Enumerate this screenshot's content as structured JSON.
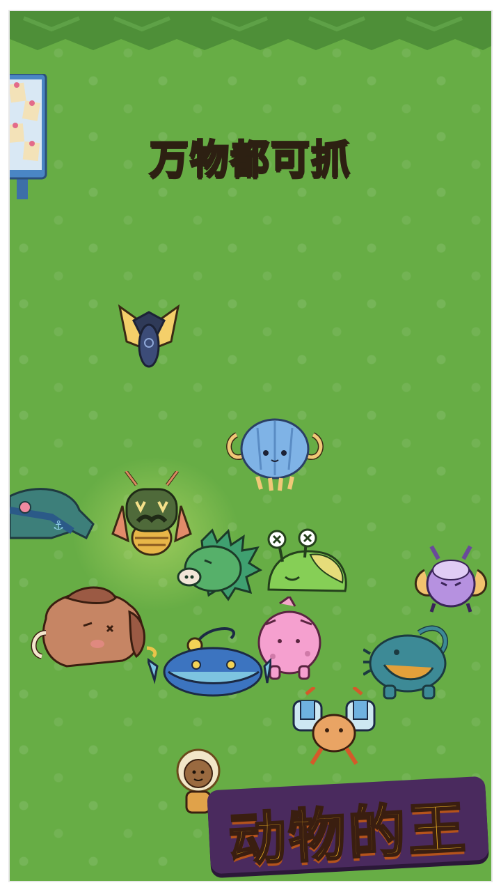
{
  "headline": "万物都可抓",
  "game_logo": "动物的王",
  "colors": {
    "grass": "#67ad45",
    "hedge": "#4e8f38",
    "headline_fill": "#f2bd27",
    "logo_fill": "#f6b824",
    "logo_panel": "#4a2a5e"
  },
  "creatures": [
    "golden-winged-beetle",
    "blue-jellyfish",
    "sleeping-blue-turtle",
    "masked-moth",
    "green-spiky-boar",
    "green-slug",
    "purple-moth",
    "brown-mammoth",
    "pink-triceratops",
    "blue-anglerfish",
    "teal-axolotl",
    "blue-claw-crab"
  ],
  "player": "explorer-character"
}
